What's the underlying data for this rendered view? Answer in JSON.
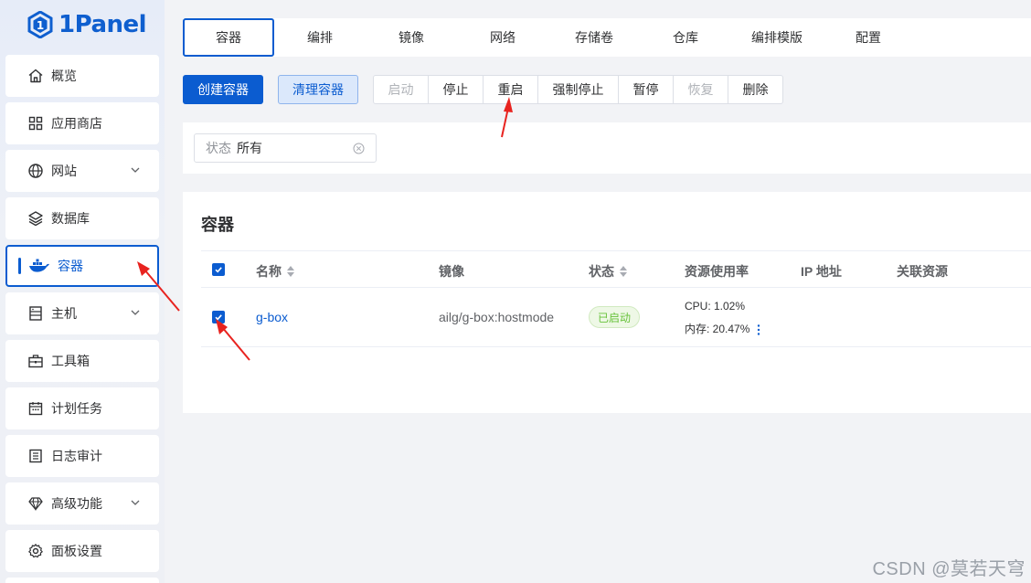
{
  "logo": {
    "text": "1Panel"
  },
  "sidebar": {
    "items": [
      {
        "label": "概览",
        "icon": "home-icon"
      },
      {
        "label": "应用商店",
        "icon": "grid-icon"
      },
      {
        "label": "网站",
        "icon": "globe-icon",
        "expandable": true
      },
      {
        "label": "数据库",
        "icon": "layers-icon"
      },
      {
        "label": "容器",
        "icon": "docker-icon",
        "active": true
      },
      {
        "label": "主机",
        "icon": "server-icon",
        "expandable": true
      },
      {
        "label": "工具箱",
        "icon": "toolbox-icon"
      },
      {
        "label": "计划任务",
        "icon": "calendar-icon"
      },
      {
        "label": "日志审计",
        "icon": "log-icon"
      },
      {
        "label": "高级功能",
        "icon": "diamond-icon",
        "expandable": true
      },
      {
        "label": "面板设置",
        "icon": "gear-icon"
      }
    ]
  },
  "tabs": [
    {
      "label": "容器",
      "active": true
    },
    {
      "label": "编排"
    },
    {
      "label": "镜像"
    },
    {
      "label": "网络"
    },
    {
      "label": "存储卷"
    },
    {
      "label": "仓库"
    },
    {
      "label": "编排模版"
    },
    {
      "label": "配置"
    }
  ],
  "toolbar": {
    "create_label": "创建容器",
    "clean_label": "清理容器",
    "group": [
      {
        "label": "启动",
        "disabled": true
      },
      {
        "label": "停止"
      },
      {
        "label": "重启"
      },
      {
        "label": "强制停止"
      },
      {
        "label": "暂停"
      },
      {
        "label": "恢复",
        "disabled": true
      },
      {
        "label": "删除"
      }
    ]
  },
  "filter": {
    "label": "状态",
    "value": "所有"
  },
  "table": {
    "title": "容器",
    "columns": [
      "名称",
      "镜像",
      "状态",
      "资源使用率",
      "IP 地址",
      "关联资源"
    ],
    "rows": [
      {
        "checked": true,
        "name": "g-box",
        "image": "ailg/g-box:hostmode",
        "status": "已启动",
        "cpu": "CPU: 1.02%",
        "mem": "内存: 20.47%"
      }
    ]
  },
  "colors": {
    "primary": "#0b5cd0",
    "success": "#67c23a",
    "annotation": "#e8231f"
  },
  "watermark": "CSDN @莫若天穹"
}
